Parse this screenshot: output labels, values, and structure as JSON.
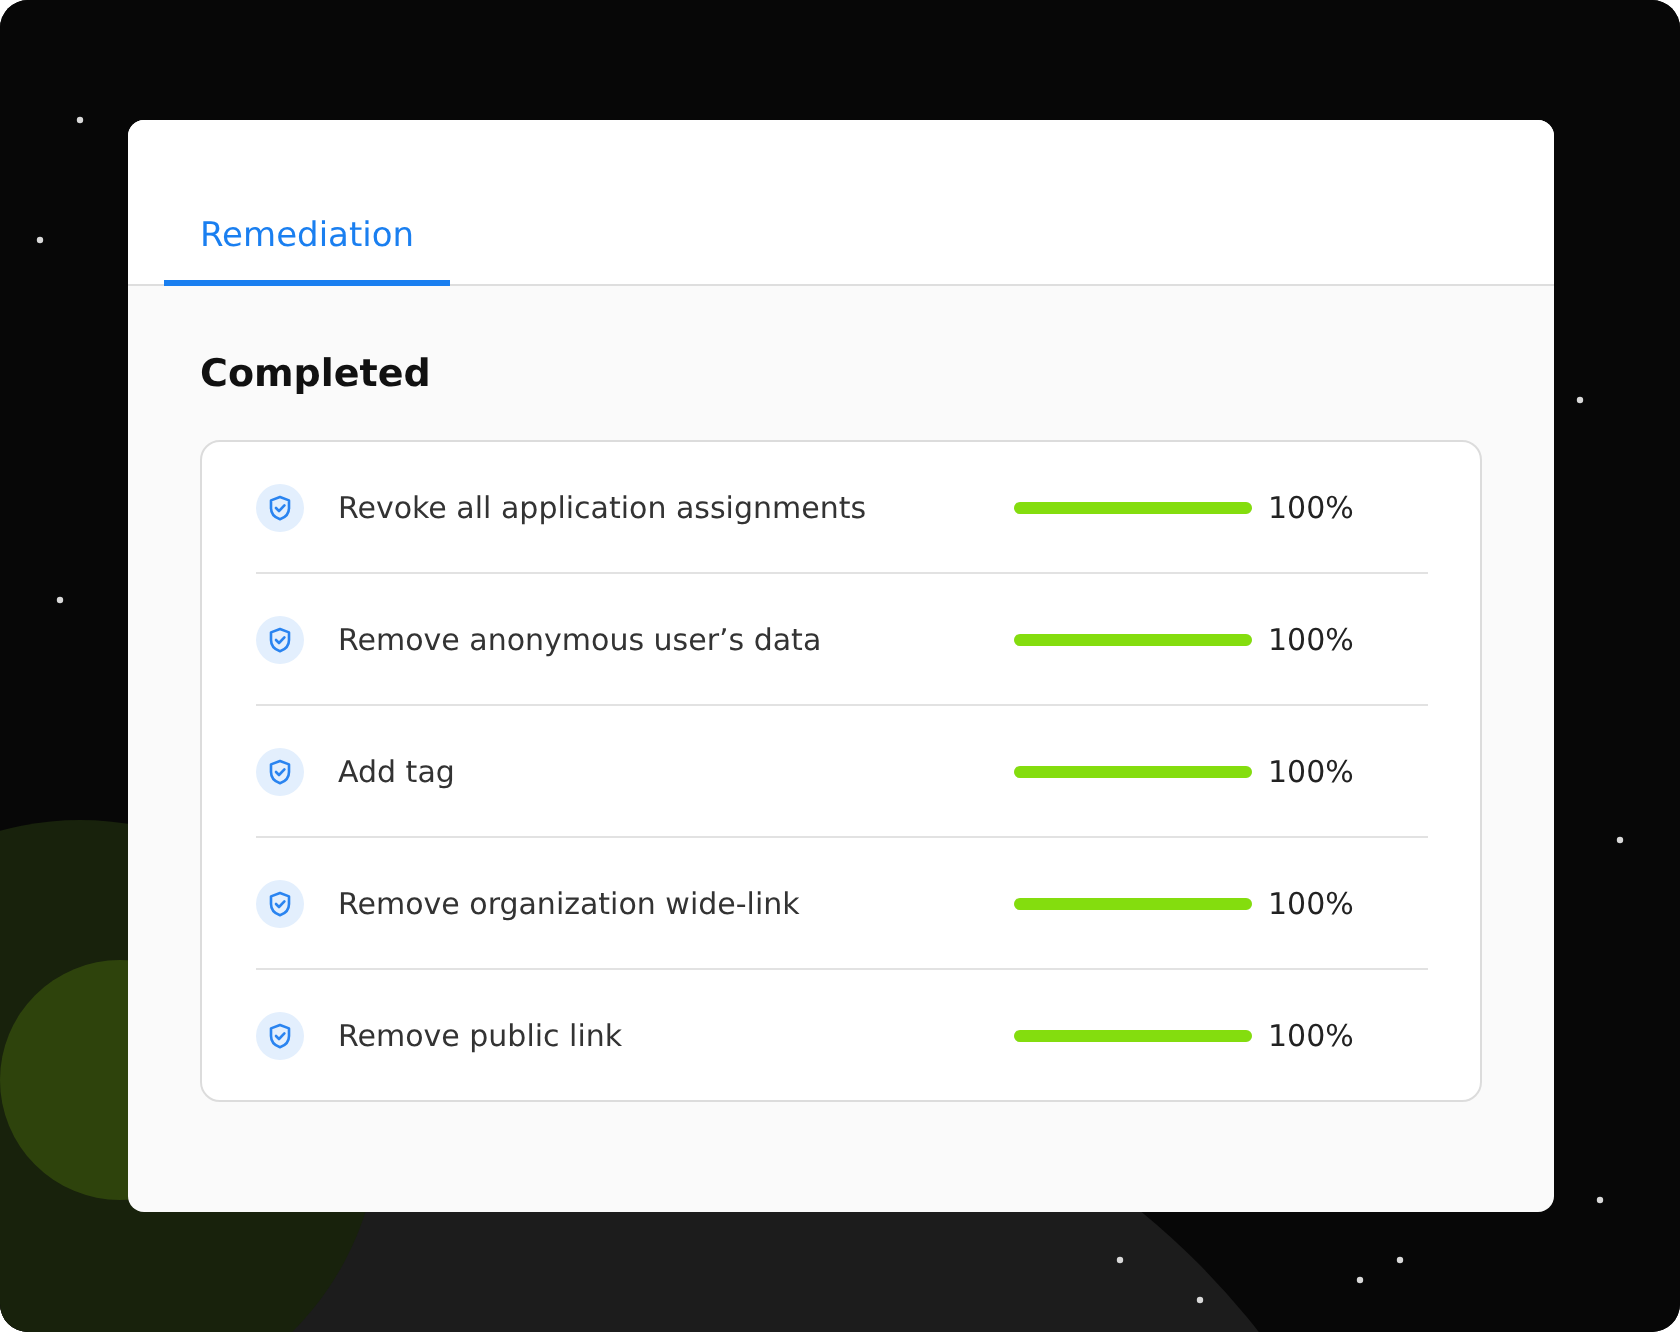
{
  "tabs": [
    {
      "label": "Remediation",
      "selected": true
    }
  ],
  "section_title": "Completed",
  "tasks": [
    {
      "label": "Revoke all application assignments",
      "level": 1,
      "reading": "100%"
    },
    {
      "label": "Remove anonymous user’s data",
      "level": 1,
      "reading": "100%"
    },
    {
      "label": "Add tag",
      "level": 1,
      "reading": "100%"
    },
    {
      "label": "Remove organization wide-link",
      "level": 1,
      "reading": "100%"
    },
    {
      "label": "Remove public link",
      "level": 1,
      "reading": "100%"
    }
  ]
}
